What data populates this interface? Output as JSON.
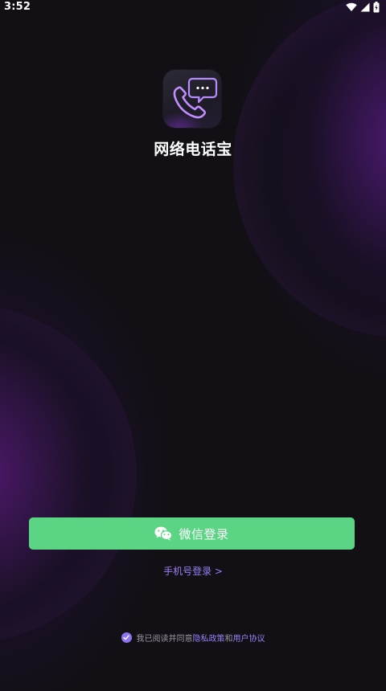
{
  "status_bar": {
    "time": "3:52",
    "icons": [
      "wifi-icon",
      "signal-icon",
      "battery-icon"
    ]
  },
  "app": {
    "name": "网络电话宝",
    "icon": "phone-chat-icon",
    "accent": "#9b7ef5"
  },
  "login": {
    "wechat_label": "微信登录",
    "wechat_icon": "wechat-icon",
    "wechat_color": "#5bd483",
    "phone_label": "手机号登录 >"
  },
  "agreement": {
    "checked": true,
    "prefix": "我已阅读并同意",
    "privacy_label": "隐私政策",
    "joiner": "和",
    "terms_label": "用户协议"
  }
}
